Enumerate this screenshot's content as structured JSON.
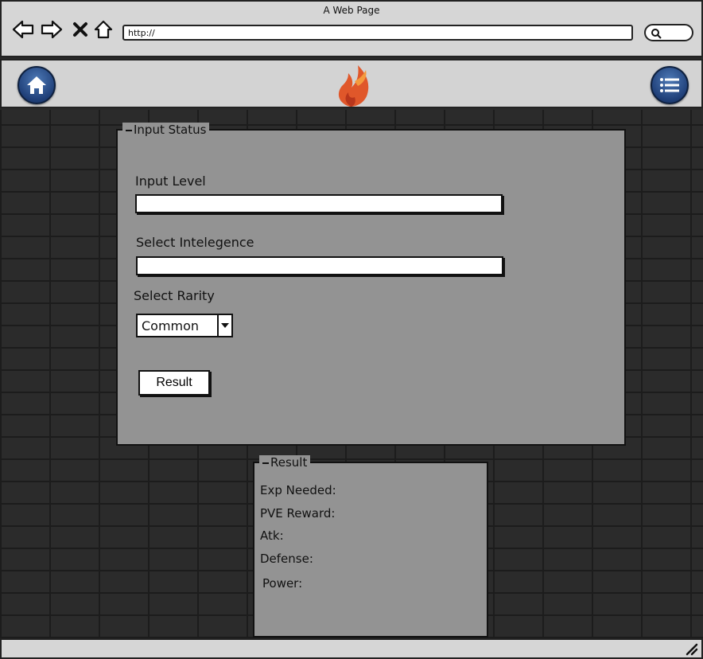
{
  "window": {
    "title": "A Web Page",
    "url": "http://"
  },
  "icons": {
    "back": "back-arrow-icon",
    "forward": "forward-arrow-icon",
    "stop": "close-icon",
    "home_nav": "home-icon",
    "search": "search-icon",
    "header_home": "home-icon",
    "menu": "menu-icon",
    "logo": "flame-logo",
    "resize": "resize-grip-icon"
  },
  "colors": {
    "accent_button": "#2a4f8f",
    "logo_flame": "#e0572a",
    "panel": "#939393"
  },
  "input_status": {
    "legend": "Input Status",
    "level_label": "Input Level",
    "level_value": "",
    "intelligence_label": "Select Intelegence",
    "intelligence_value": "",
    "rarity_label": "Select Rarity",
    "rarity_selected": "Common",
    "result_button": "Result"
  },
  "result": {
    "legend": "Result",
    "lines": [
      "Exp Needed:",
      "PVE Reward:",
      "Atk:",
      "Defense:",
      "Power:"
    ]
  }
}
